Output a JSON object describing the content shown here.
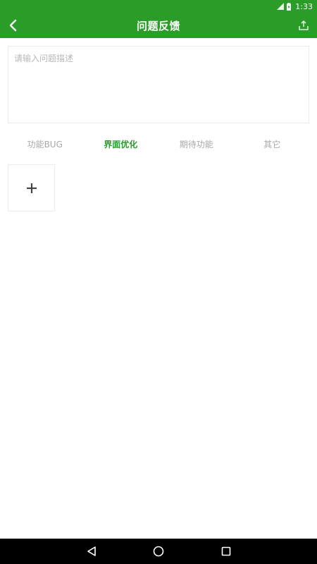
{
  "status_bar": {
    "time": "1:33",
    "icons": [
      "signal-icon",
      "battery-charging-icon"
    ]
  },
  "app_bar": {
    "title": "问题反馈",
    "back_icon": "chevron-left-icon",
    "action_icon": "upload-icon"
  },
  "feedback": {
    "placeholder": "请输入问题描述",
    "value": ""
  },
  "categories": {
    "items": [
      {
        "label": "功能BUG",
        "selected": false
      },
      {
        "label": "界面优化",
        "selected": true
      },
      {
        "label": "期待功能",
        "selected": false
      },
      {
        "label": "其它",
        "selected": false
      }
    ]
  },
  "attachments": {
    "add_icon": "plus-icon"
  },
  "nav_bar": {
    "icons": [
      "back-triangle-icon",
      "home-circle-icon",
      "recents-square-icon"
    ]
  },
  "colors": {
    "brand_green": "#2a9c28",
    "inactive_text": "#a8a8a8",
    "border": "#ececec"
  }
}
